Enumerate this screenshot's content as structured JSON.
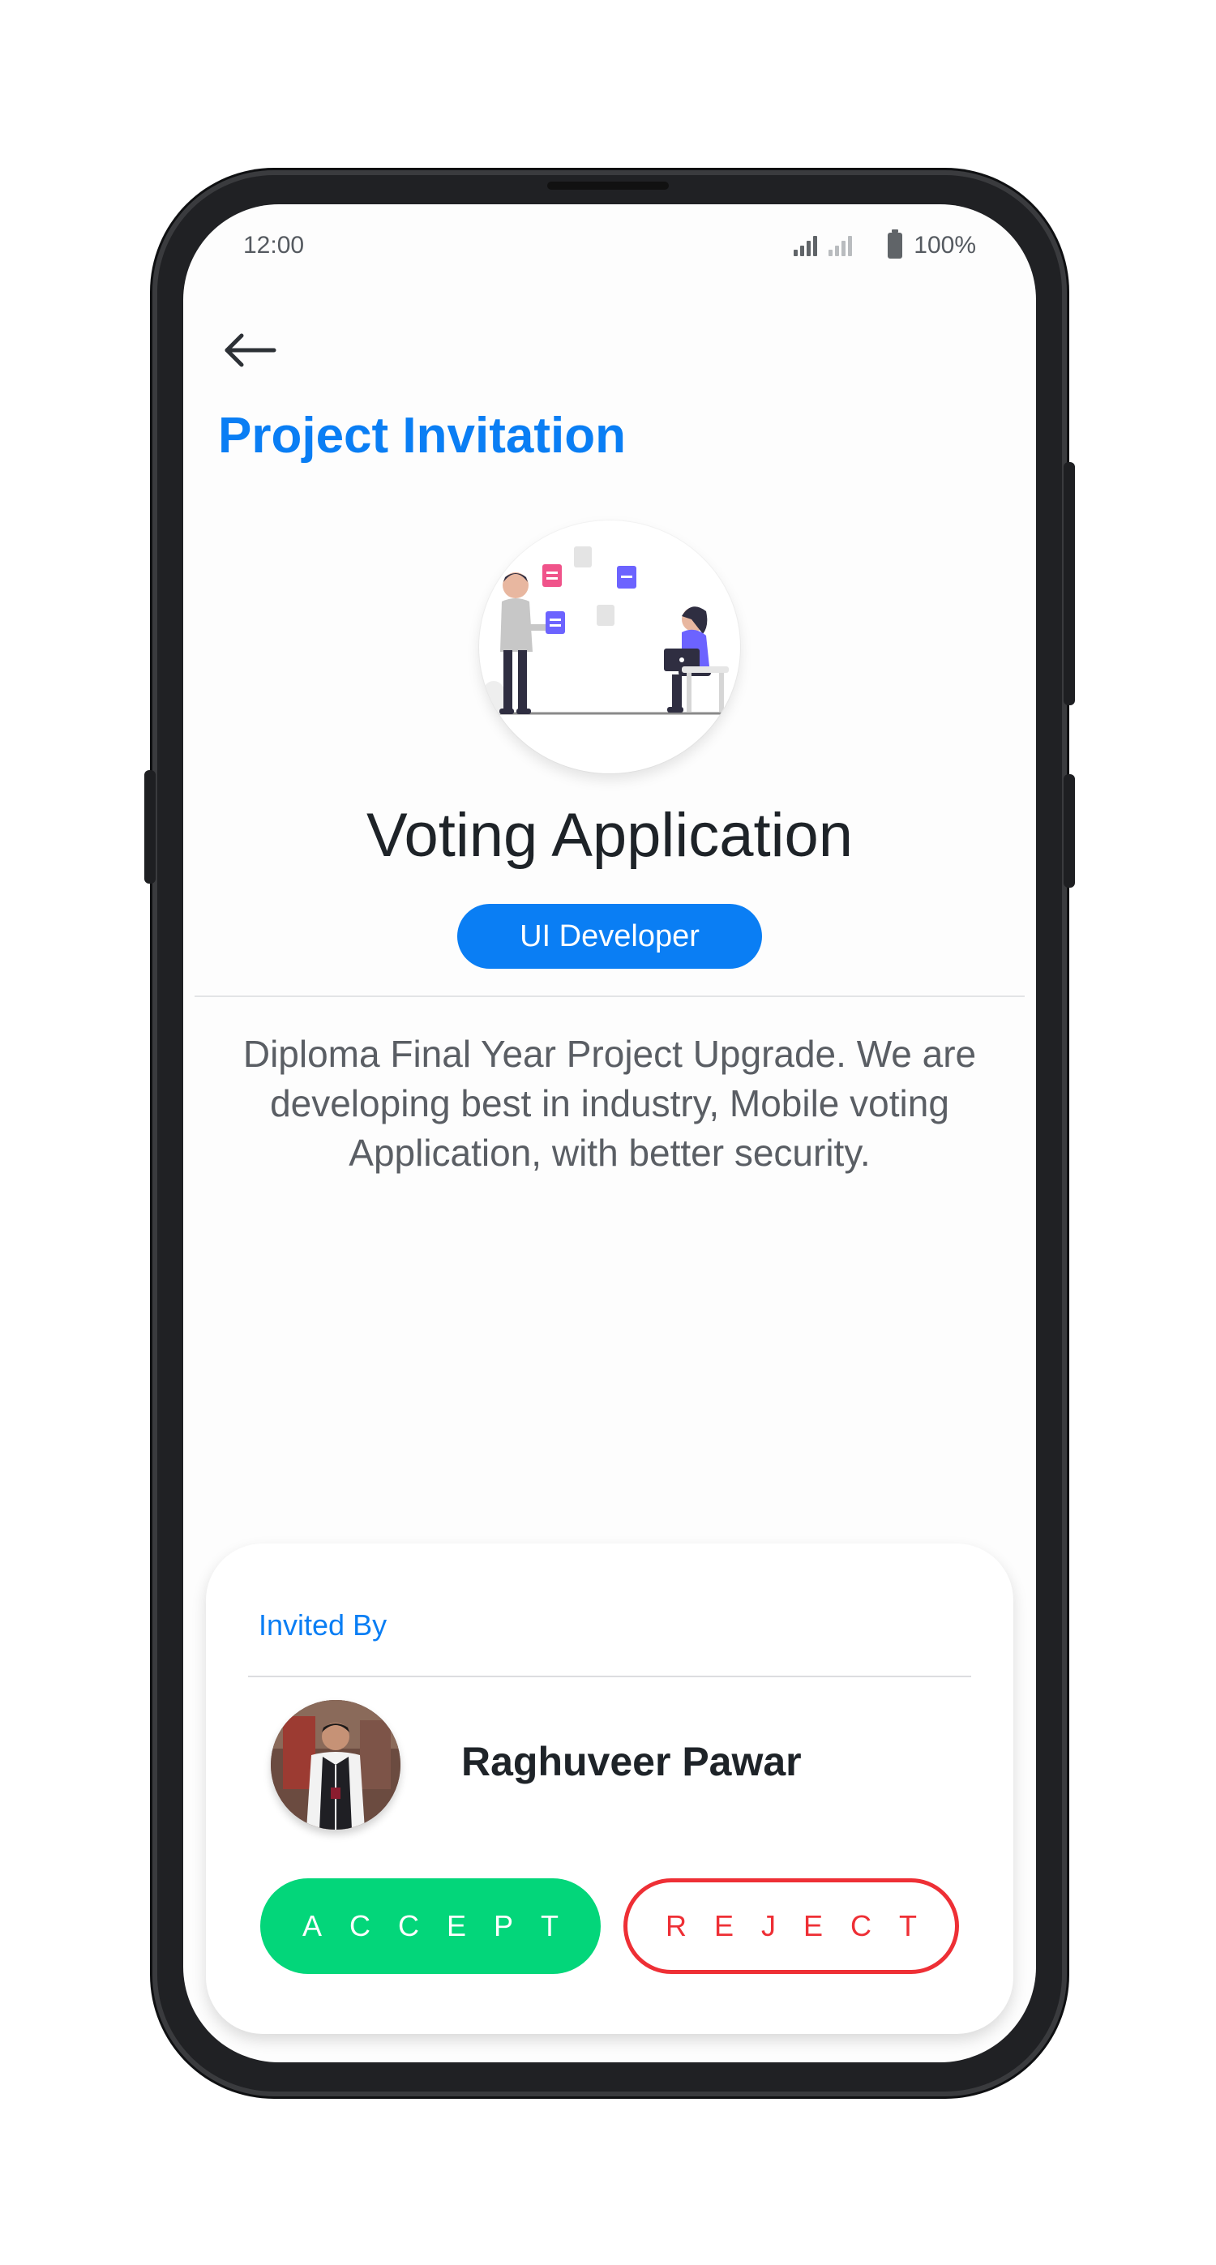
{
  "status_bar": {
    "time": "12:00",
    "battery": "100%"
  },
  "header": {
    "back_icon": "arrow-left-icon",
    "title": "Project Invitation"
  },
  "project": {
    "illustration": "team-collaboration-illustration",
    "name": "Voting Application",
    "role": "UI Developer",
    "description": "Diploma Final Year Project Upgrade. We are developing best in industry, Mobile voting Application, with better security."
  },
  "invitation": {
    "label": "Invited By",
    "inviter_name": "Raghuveer Pawar",
    "accept_label": "ACCEPT",
    "reject_label": "REJECT"
  },
  "colors": {
    "primary": "#0a7ef4",
    "accept": "#03d67a",
    "reject": "#ee2f35",
    "text_dark": "#1e2328",
    "text_muted": "#5a5e64"
  }
}
